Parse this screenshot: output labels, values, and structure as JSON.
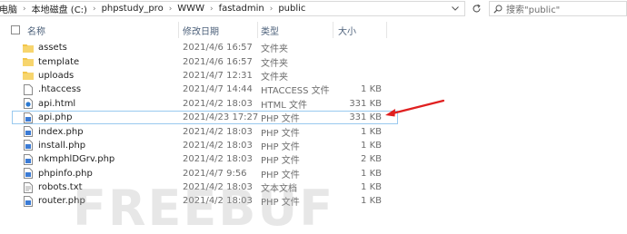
{
  "address": {
    "crumbs": [
      "此电脑",
      "本地磁盘 (C:)",
      "phpstudy_pro",
      "WWW",
      "fastadmin",
      "public"
    ]
  },
  "search": {
    "placeholder": "搜索\"public\""
  },
  "columns": {
    "name": "名称",
    "date": "修改日期",
    "type": "类型",
    "size": "大小"
  },
  "files": [
    {
      "name": "assets",
      "date": "2021/4/6 16:57",
      "type": "文件夹",
      "size": "",
      "icon": "folder-icon"
    },
    {
      "name": "template",
      "date": "2021/4/6 16:57",
      "type": "文件夹",
      "size": "",
      "icon": "folder-icon"
    },
    {
      "name": "uploads",
      "date": "2021/4/7 12:31",
      "type": "文件夹",
      "size": "",
      "icon": "folder-icon"
    },
    {
      "name": ".htaccess",
      "date": "2021/4/7 14:44",
      "type": "HTACCESS 文件",
      "size": "1 KB",
      "icon": "file-icon"
    },
    {
      "name": "api.html",
      "date": "2021/4/2 18:03",
      "type": "HTML 文件",
      "size": "331 KB",
      "icon": "html-file-icon"
    },
    {
      "name": "api.php",
      "date": "2021/4/23 17:27",
      "type": "PHP 文件",
      "size": "331 KB",
      "icon": "php-file-icon"
    },
    {
      "name": "index.php",
      "date": "2021/4/2 18:03",
      "type": "PHP 文件",
      "size": "1 KB",
      "icon": "php-file-icon"
    },
    {
      "name": "install.php",
      "date": "2021/4/2 18:03",
      "type": "PHP 文件",
      "size": "1 KB",
      "icon": "php-file-icon"
    },
    {
      "name": "nkmphlDGrv.php",
      "date": "2021/4/2 18:03",
      "type": "PHP 文件",
      "size": "2 KB",
      "icon": "php-file-icon"
    },
    {
      "name": "phpinfo.php",
      "date": "2021/4/7 9:56",
      "type": "PHP 文件",
      "size": "1 KB",
      "icon": "php-file-icon"
    },
    {
      "name": "robots.txt",
      "date": "2021/4/2 18:03",
      "type": "文本文档",
      "size": "1 KB",
      "icon": "text-file-icon"
    },
    {
      "name": "router.php",
      "date": "2021/4/2 18:03",
      "type": "PHP 文件",
      "size": "1 KB",
      "icon": "php-file-icon"
    }
  ],
  "watermark": "FREEBUF",
  "colors": {
    "folder": "#f2c54a",
    "php": "#3b7bd5",
    "selection_border": "#99c9ef",
    "arrow": "#e02020"
  }
}
